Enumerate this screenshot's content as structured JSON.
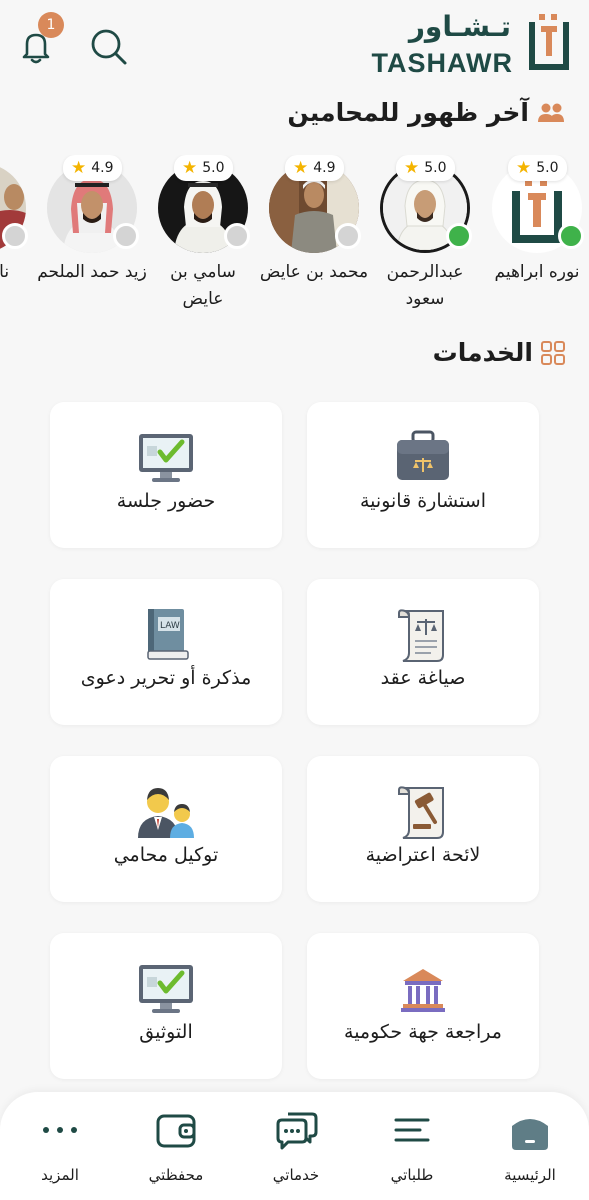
{
  "header": {
    "logo_arabic": "تـشـاور",
    "logo_english": "TASHAWR",
    "notification_count": "1",
    "icons": [
      "bell-icon",
      "search-icon"
    ]
  },
  "lawyers_section": {
    "title": "آخر ظهور للمحامين",
    "icon": "people-icon",
    "lawyers": [
      {
        "name": "نوره ابراهيم",
        "rating": "5.0",
        "status": "online"
      },
      {
        "name": "عبدالرحمن سعود",
        "rating": "5.0",
        "status": "online"
      },
      {
        "name": "محمد بن عايض",
        "rating": "4.9",
        "status": "offline"
      },
      {
        "name": "سامي بن عايض",
        "rating": "5.0",
        "status": "offline"
      },
      {
        "name": "زيد حمد الملحم",
        "rating": "4.9",
        "status": "offline"
      },
      {
        "name": "ناصر ال",
        "rating": "",
        "status": "offline"
      }
    ]
  },
  "services_section": {
    "title": "الخدمات",
    "icon": "grid-icon",
    "services": [
      {
        "label": "استشارة قانونية",
        "icon": "briefcase-icon"
      },
      {
        "label": "حضور جلسة",
        "icon": "monitor-check-icon"
      },
      {
        "label": "صياغة عقد",
        "icon": "contract-scroll-icon"
      },
      {
        "label": "مذكرة أو تحرير دعوى",
        "icon": "law-book-icon"
      },
      {
        "label": "لائحة اعتراضية",
        "icon": "gavel-scroll-icon"
      },
      {
        "label": "توكيل محامي",
        "icon": "lawyer-client-icon"
      },
      {
        "label": "مراجعة جهة حكومية",
        "icon": "government-building-icon"
      },
      {
        "label": "التوثيق",
        "icon": "monitor-check-icon"
      }
    ]
  },
  "tabbar": {
    "tabs": [
      {
        "label": "الرئيسية",
        "icon": "home-icon",
        "active": true
      },
      {
        "label": "طلباتي",
        "icon": "list-icon",
        "active": false
      },
      {
        "label": "خدماتي",
        "icon": "chat-icon",
        "active": false
      },
      {
        "label": "محفظتي",
        "icon": "wallet-icon",
        "active": false
      },
      {
        "label": "المزيد",
        "icon": "more-icon",
        "active": false
      }
    ]
  },
  "colors": {
    "brand": "#1f4a45",
    "accent": "#d9895a",
    "online": "#3fb24a",
    "star": "#f4b400"
  }
}
